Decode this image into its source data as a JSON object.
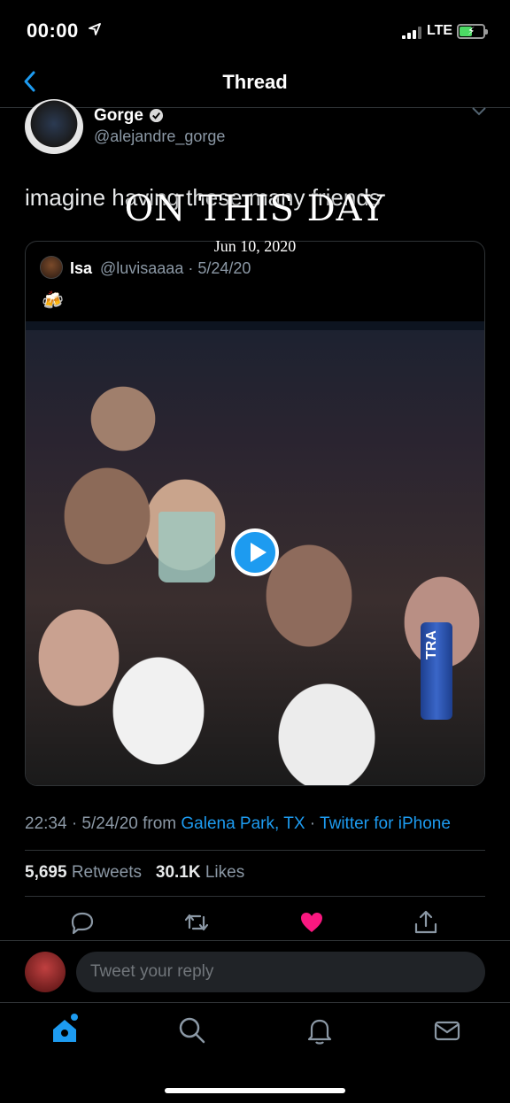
{
  "status_bar": {
    "time": "00:00",
    "network": "LTE"
  },
  "nav": {
    "title": "Thread"
  },
  "tweet": {
    "author_name": "Gorge",
    "author_handle": "@alejandre_gorge",
    "text": "imagine having these many friends",
    "meta_prefix": "22:34 · 5/24/20 from ",
    "location": "Galena Park, TX",
    "separator": " · ",
    "client": "Twitter for iPhone",
    "retweets_count": "5,695",
    "retweets_label": " Retweets",
    "likes_count": "30.1K",
    "likes_label": " Likes",
    "liked": true
  },
  "overlay": {
    "title": "ON THIS DAY",
    "date": "Jun 10, 2020"
  },
  "quote": {
    "name": "Isa",
    "handle_date": "@luvisaaaa · 5/24/20",
    "emoji": "🍻",
    "media_text": "TRA"
  },
  "reply": {
    "placeholder": "Tweet your reply"
  },
  "tabs": [
    "home-icon",
    "search-icon",
    "notifications-icon",
    "messages-icon"
  ],
  "colors": {
    "accent": "#1d9bf0",
    "like": "#f91880",
    "background": "#000000"
  }
}
